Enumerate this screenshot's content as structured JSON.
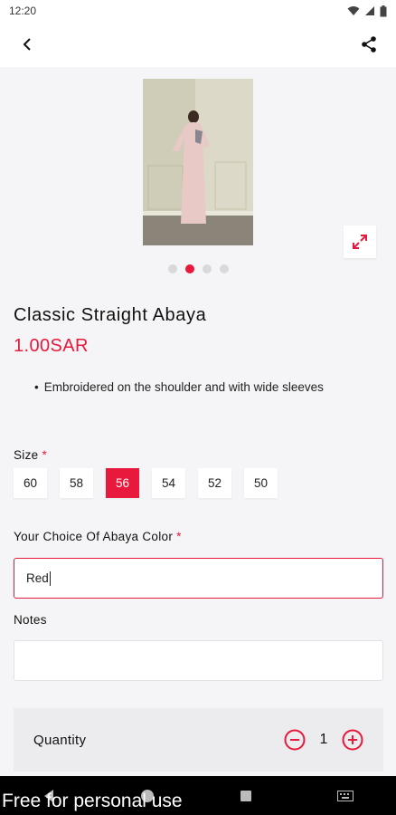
{
  "status_bar": {
    "time": "12:20"
  },
  "product": {
    "title": "Classic Straight Abaya",
    "price": "1.00SAR",
    "bullets": [
      "Embroidered on the shoulder and with wide sleeves"
    ]
  },
  "gallery": {
    "dot_count": 4,
    "active_index": 1
  },
  "size_section": {
    "label": "Size",
    "required_mark": "*",
    "options": [
      "60",
      "58",
      "56",
      "54",
      "52",
      "50"
    ],
    "selected": "56"
  },
  "color_section": {
    "label": "Your Choice Of Abaya Color",
    "required_mark": "*",
    "value": "Red"
  },
  "notes_section": {
    "label": "Notes",
    "value": ""
  },
  "quantity": {
    "label": "Quantity",
    "value": "1"
  },
  "watermark": "Free for personal use",
  "colors": {
    "accent": "#e8193c",
    "background": "#f5f5f7"
  }
}
